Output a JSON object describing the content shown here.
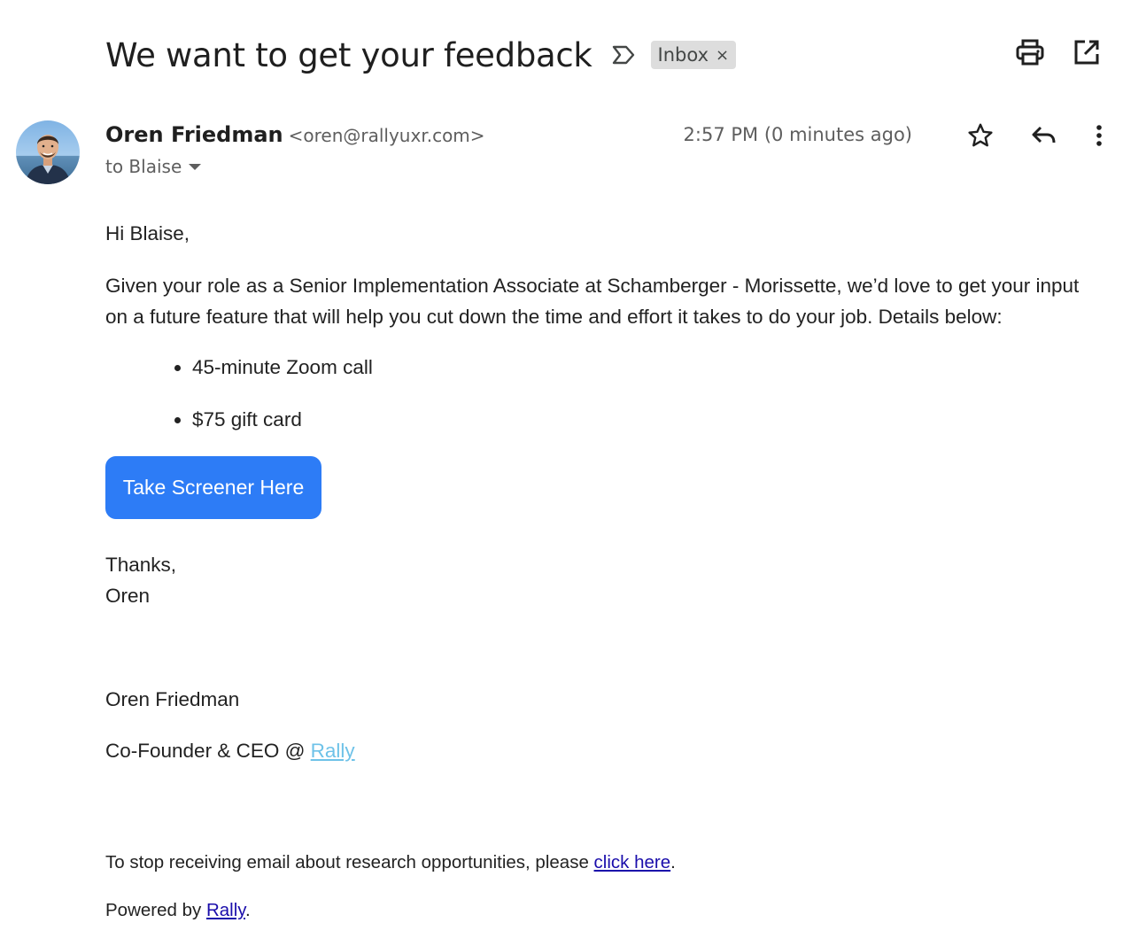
{
  "email": {
    "subject": "We want to get your feedback",
    "label": "Inbox",
    "label_remove": "×",
    "sender_name": "Oren Friedman",
    "sender_email": "<oren@rallyuxr.com>",
    "to": "to Blaise",
    "timestamp": "2:57 PM (0 minutes ago)"
  },
  "icons": {
    "importance": "importance-marker-icon",
    "print": "print-icon",
    "open_new_window": "open-in-new-window-icon",
    "star": "star-icon",
    "reply": "reply-icon",
    "more": "more-vert-icon"
  },
  "body": {
    "greeting": "Hi Blaise,",
    "intro": "Given your role as a Senior Implementation Associate at Schamberger - Morissette, we’d love to get your input on a future feature that will help you cut down the time and effort it takes to do your job. Details below:",
    "details": [
      "45-minute Zoom call",
      "$75 gift card"
    ],
    "cta_label": "Take Screener Here",
    "thanks": "Thanks,",
    "sign_name": "Oren",
    "sig_full_name": "Oren Friedman",
    "sig_title_prefix": "Co-Founder & CEO @ ",
    "sig_link": "Rally",
    "unsubscribe_prefix": "To stop receiving email about research opportunities, please ",
    "unsubscribe_link": "click here",
    "unsubscribe_suffix": ".",
    "powered_prefix": "Powered by ",
    "powered_link": "Rally",
    "powered_suffix": "."
  },
  "colors": {
    "cta_background": "#2d7cf6",
    "link": "#1a0dab",
    "signature_link": "#6ec2e8"
  }
}
